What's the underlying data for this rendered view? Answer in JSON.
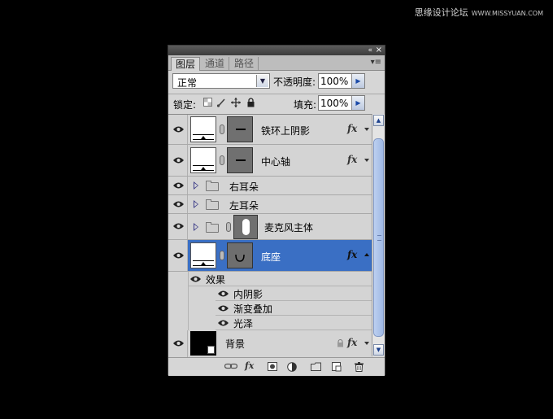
{
  "watermark": {
    "cn": "思缘设计论坛",
    "url": "WWW.MISSYUAN.COM"
  },
  "titlebar": {
    "collapse_icon": "«",
    "close_icon": "×"
  },
  "tabs": [
    {
      "label": "图层",
      "active": true
    },
    {
      "label": "通道",
      "active": false
    },
    {
      "label": "路径",
      "active": false
    }
  ],
  "panel_menu_icon": "▾≡",
  "blend": {
    "mode": "正常",
    "opacity_label": "不透明度:",
    "opacity": "100%"
  },
  "lock": {
    "label": "锁定:",
    "fill_label": "填充:",
    "fill": "100%"
  },
  "layers": [
    {
      "name": "铁环上阴影",
      "fx": "fx"
    },
    {
      "name": "中心轴",
      "fx": "fx"
    },
    {
      "name": "右耳朵"
    },
    {
      "name": "左耳朵"
    },
    {
      "name": "麦克风主体"
    },
    {
      "name": "底座",
      "fx": "fx",
      "selected": true
    },
    {
      "name": "背景",
      "fx": "fx"
    }
  ],
  "effects": {
    "header": "效果",
    "items": [
      "内阴影",
      "渐变叠加",
      "光泽"
    ]
  },
  "colors": {
    "selected": "#3a6fc4",
    "panel_bg": "#d6d6d6",
    "canvas_bg": "#000000"
  }
}
